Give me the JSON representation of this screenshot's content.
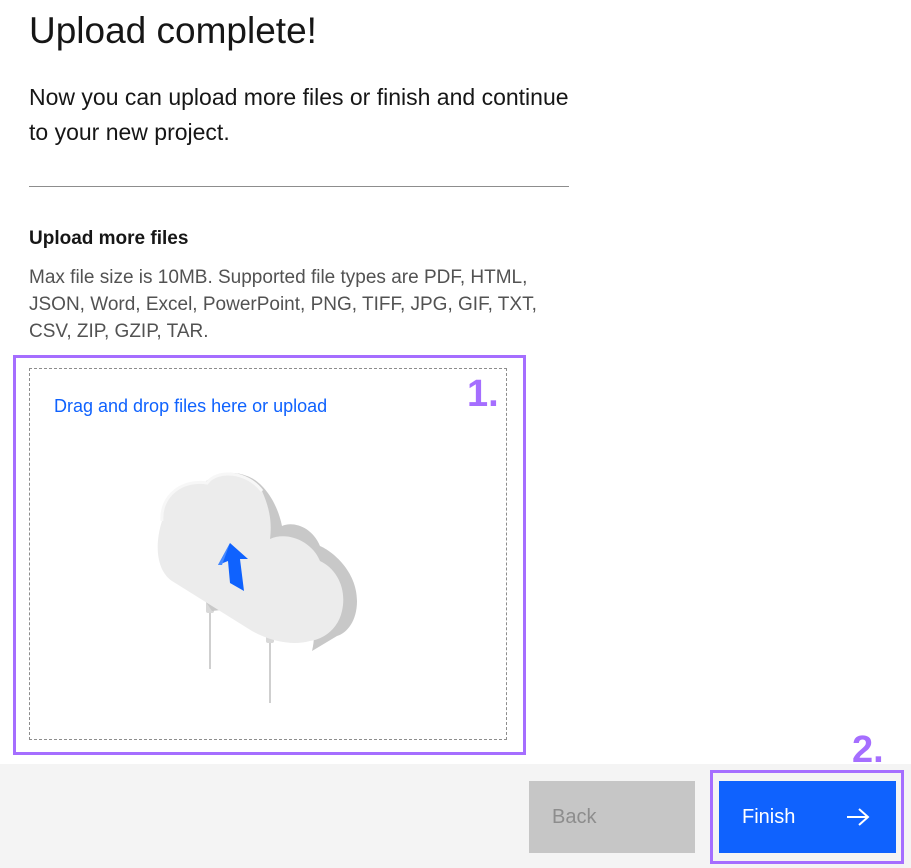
{
  "page": {
    "title": "Upload complete!",
    "subtitle": "Now you can upload more files or finish and continue to your new project."
  },
  "upload_section": {
    "heading": "Upload more files",
    "helper": "Max file size is 10MB. Supported file types are PDF, HTML, JSON, Word, Excel, PowerPoint, PNG, TIFF, JPG, GIF, TXT, CSV, ZIP, GZIP, TAR.",
    "dropzone_label": "Drag and drop files here or upload",
    "illustration_icon": "cloud-upload-icon"
  },
  "annotations": {
    "marker_1": "1.",
    "marker_2": "2."
  },
  "footer": {
    "back_label": "Back",
    "finish_label": "Finish",
    "finish_icon": "arrow-right-icon"
  },
  "colors": {
    "primary": "#0f62fe",
    "highlight": "#a56eff",
    "disabled_bg": "#c6c6c6",
    "disabled_text": "#8d8d8d",
    "footer_bg": "#f4f4f4"
  }
}
